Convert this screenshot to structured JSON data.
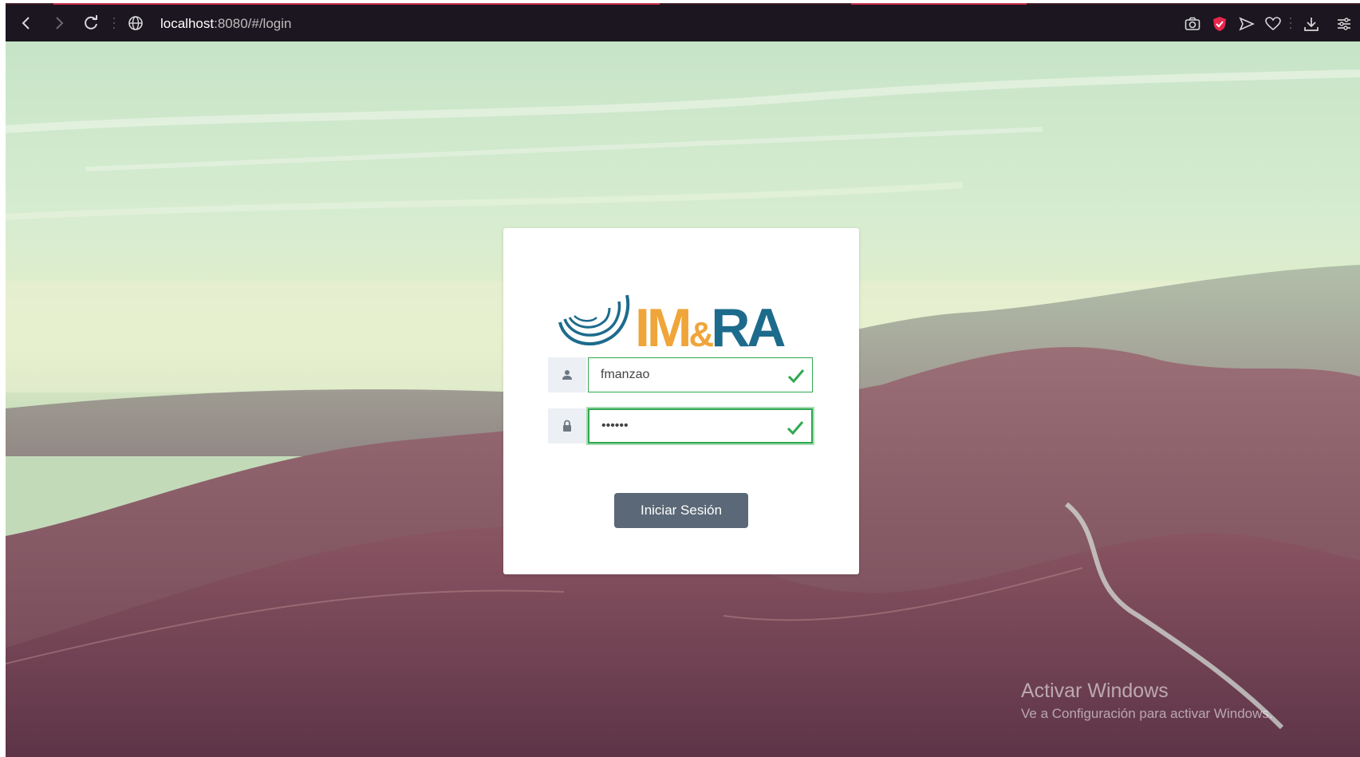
{
  "browser": {
    "url_host": "localhost",
    "url_rest": ":8080/#/login",
    "icons": [
      "back-icon",
      "forward-icon",
      "reload-icon",
      "globe-icon",
      "camera-icon",
      "shield-icon",
      "send-icon",
      "heart-icon",
      "download-icon",
      "menu-icon"
    ]
  },
  "login": {
    "logo_text": "IM&RA",
    "username_value": "fmanzao",
    "password_value": "••••••",
    "submit_label": "Iniciar Sesión",
    "colors": {
      "success": "#2fa84f",
      "button": "#5b6877",
      "logo_blue": "#1d6b8c",
      "logo_orange": "#f0a53a"
    }
  },
  "watermark": {
    "title": "Activar Windows",
    "subtitle": "Ve a Configuración para activar Windows."
  }
}
